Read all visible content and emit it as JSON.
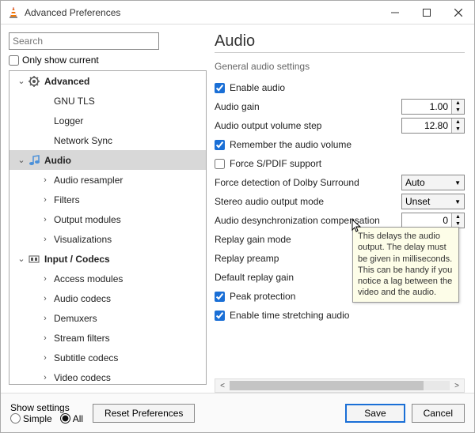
{
  "window": {
    "title": "Advanced Preferences"
  },
  "search": {
    "placeholder": "Search"
  },
  "only_show_current": "Only show current",
  "tree": {
    "items": [
      {
        "label": "Advanced",
        "depth": 0,
        "top": true,
        "exp": "v",
        "icon": "gear"
      },
      {
        "label": "GNU TLS",
        "depth": 1
      },
      {
        "label": "Logger",
        "depth": 1
      },
      {
        "label": "Network Sync",
        "depth": 1
      },
      {
        "label": "Audio",
        "depth": 0,
        "top": true,
        "exp": "v",
        "icon": "note",
        "selected": true
      },
      {
        "label": "Audio resampler",
        "depth": 1,
        "exp": ">"
      },
      {
        "label": "Filters",
        "depth": 1,
        "exp": ">"
      },
      {
        "label": "Output modules",
        "depth": 1,
        "exp": ">"
      },
      {
        "label": "Visualizations",
        "depth": 1,
        "exp": ">"
      },
      {
        "label": "Input / Codecs",
        "depth": 0,
        "top": true,
        "exp": "v",
        "icon": "codec"
      },
      {
        "label": "Access modules",
        "depth": 1,
        "exp": ">"
      },
      {
        "label": "Audio codecs",
        "depth": 1,
        "exp": ">"
      },
      {
        "label": "Demuxers",
        "depth": 1,
        "exp": ">"
      },
      {
        "label": "Stream filters",
        "depth": 1,
        "exp": ">"
      },
      {
        "label": "Subtitle codecs",
        "depth": 1,
        "exp": ">"
      },
      {
        "label": "Video codecs",
        "depth": 1,
        "exp": ">"
      }
    ]
  },
  "page": {
    "title": "Audio",
    "section": "General audio settings",
    "enable_audio": "Enable audio",
    "audio_gain": "Audio gain",
    "audio_gain_val": "1.00",
    "volume_step": "Audio output volume step",
    "volume_step_val": "12.80",
    "remember": "Remember the audio volume",
    "force_spdif": "Force S/PDIF support",
    "dolby": "Force detection of Dolby Surround",
    "dolby_val": "Auto",
    "stereo": "Stereo audio output mode",
    "stereo_val": "Unset",
    "desync": "Audio desynchronization compensation",
    "desync_val": "0",
    "replay_mode": "Replay gain mode",
    "replay_preamp": "Replay preamp",
    "default_replay": "Default replay gain",
    "peak": "Peak protection",
    "time_stretch": "Enable time stretching audio"
  },
  "tooltip": "This delays the audio output. The delay must be given in milliseconds. This can be handy if you notice a lag between the video and the audio.",
  "footer": {
    "show_settings": "Show settings",
    "simple": "Simple",
    "all": "All",
    "reset": "Reset Preferences",
    "save": "Save",
    "cancel": "Cancel"
  }
}
